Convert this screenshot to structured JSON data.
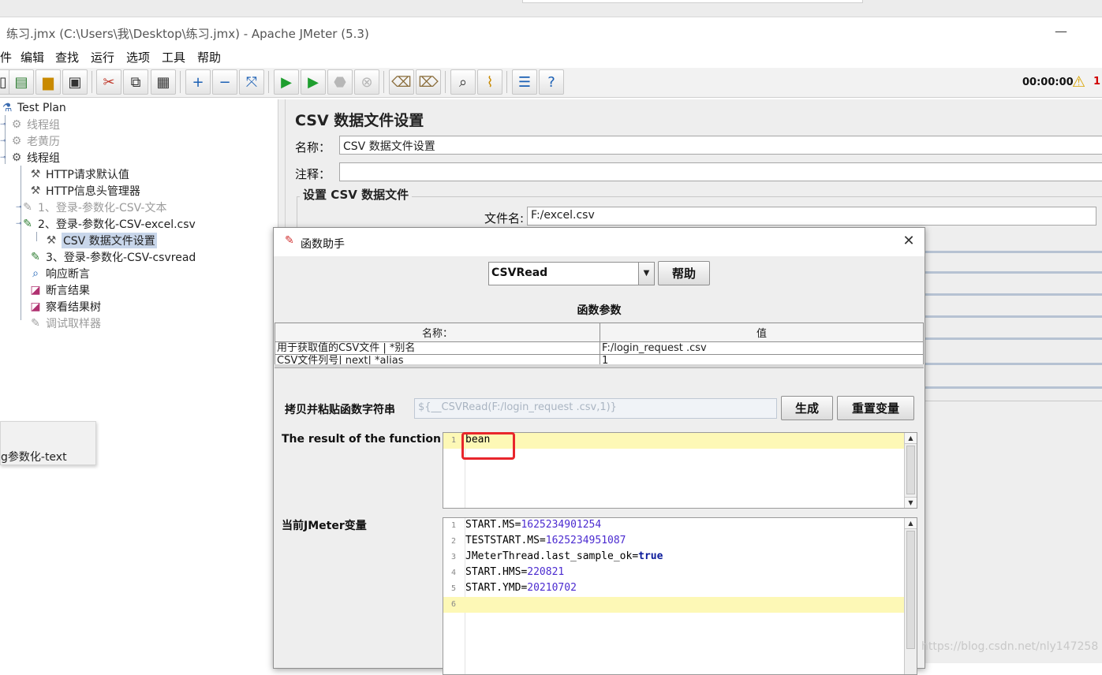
{
  "window": {
    "title": "练习.jmx (C:\\Users\\我\\Desktop\\练习.jmx) - Apache JMeter (5.3)",
    "minimize_glyph": "—"
  },
  "menu": {
    "items": [
      "件",
      "编辑",
      "查找",
      "运行",
      "选项",
      "工具",
      "帮助"
    ]
  },
  "toolbar": {
    "timer": "00:00:00",
    "warning_count": "1"
  },
  "tree": {
    "items": [
      {
        "label": "Test Plan",
        "enabled": true
      },
      {
        "label": "线程组",
        "enabled": false
      },
      {
        "label": "老黄历",
        "enabled": false
      },
      {
        "label": "线程组",
        "enabled": true
      },
      {
        "label": "HTTP请求默认值",
        "enabled": true
      },
      {
        "label": "HTTP信息头管理器",
        "enabled": true
      },
      {
        "label": "1、登录-参数化-CSV-文本",
        "enabled": false
      },
      {
        "label": "2、登录-参数化-CSV-excel.csv",
        "enabled": true
      },
      {
        "label": "CSV 数据文件设置",
        "enabled": true,
        "selected": true
      },
      {
        "label": "3、登录-参数化-CSV-csvread",
        "enabled": true
      },
      {
        "label": "响应断言",
        "enabled": true
      },
      {
        "label": "断言结果",
        "enabled": true
      },
      {
        "label": "察看结果树",
        "enabled": true
      },
      {
        "label": "调试取样器",
        "enabled": false
      }
    ]
  },
  "floating": {
    "text": "g参数化-text"
  },
  "panel": {
    "title": "CSV 数据文件设置",
    "name_label": "名称：",
    "name_value": "CSV 数据文件设置",
    "comment_label": "注释：",
    "comment_value": "",
    "group_title": "设置 CSV 数据文件",
    "filename_label": "文件名:",
    "filename_value": "F:/excel.csv"
  },
  "dialog": {
    "title": "函数助手",
    "function_select": "CSVRead",
    "help_button": "帮助",
    "params_label": "函数参数",
    "table": {
      "headers": [
        "名称：",
        "值"
      ],
      "rows": [
        [
          "用于获取值的CSV文件 | *别名",
          "F:/login_request .csv"
        ],
        [
          "CSV文件列号| next| *alias",
          "1"
        ]
      ]
    },
    "copy_label": "拷贝并粘贴函数字符串",
    "function_string": "${__CSVRead(F:/login_request .csv,1)}",
    "generate_button": "生成",
    "reset_button": "重置变量",
    "result_label": "The result of the function is",
    "result_lines": [
      "bean"
    ],
    "vars_label": "当前JMeter变量",
    "variables": [
      {
        "key": "START.MS",
        "value": "1625234901254"
      },
      {
        "key": "TESTSTART.MS",
        "value": "1625234951087"
      },
      {
        "key": "JMeterThread.last_sample_ok",
        "value": "true"
      },
      {
        "key": "START.HMS",
        "value": "220821"
      },
      {
        "key": "START.YMD",
        "value": "20210702"
      }
    ]
  },
  "watermark": "https://blog.csdn.net/nly147258",
  "colors": {
    "accent_highlight": "#e8262c",
    "editor_line_highlight": "#fdf8b6",
    "tree_selection": "#c8d6ea"
  }
}
